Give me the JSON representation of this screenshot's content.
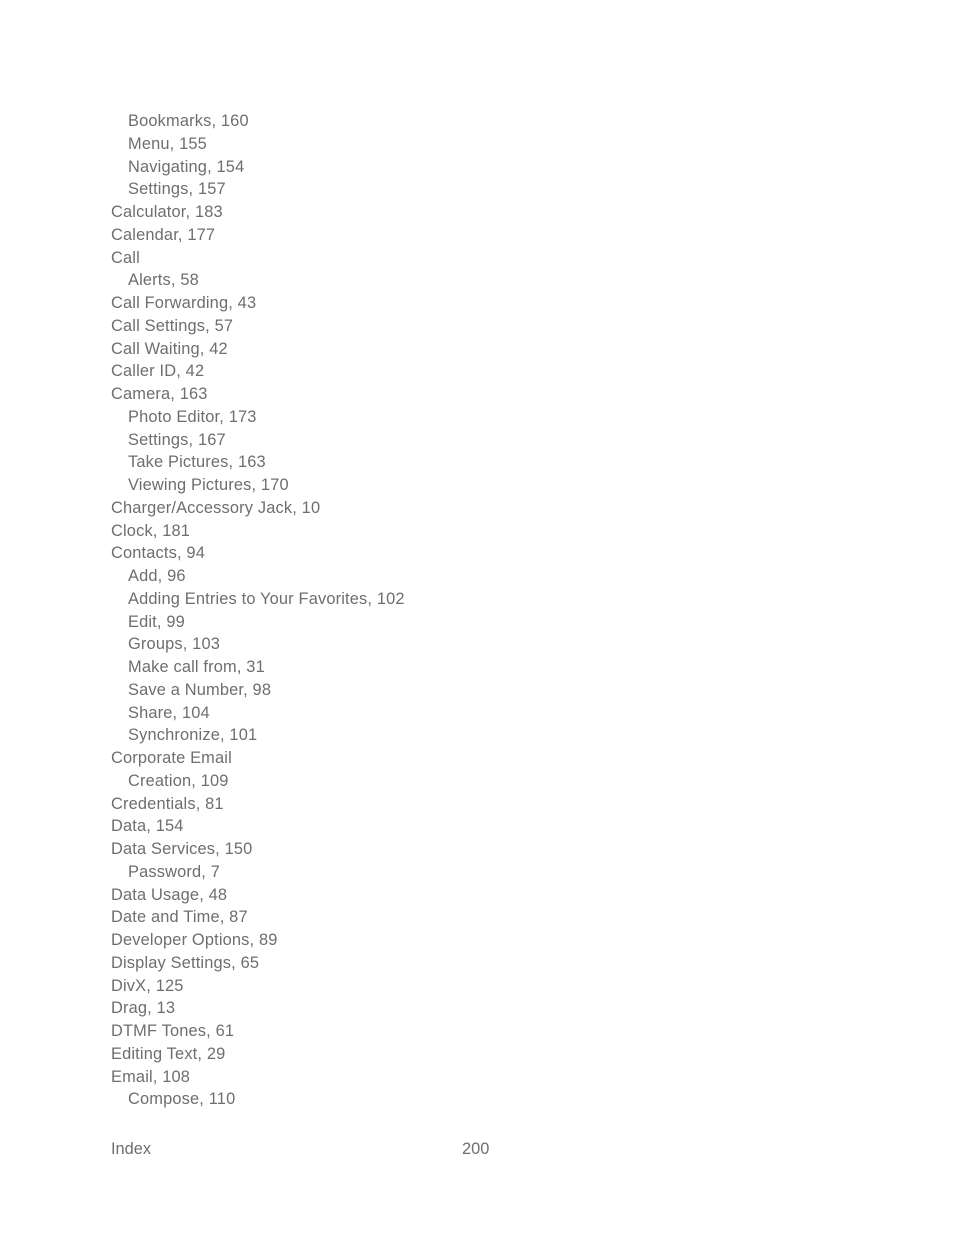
{
  "page": {
    "background_color": "#ffffff",
    "text_color": "#6e6e6e"
  },
  "index": {
    "entries": [
      {
        "text": "Bookmarks, 160",
        "level": 1
      },
      {
        "text": "Menu, 155",
        "level": 1
      },
      {
        "text": "Navigating, 154",
        "level": 1
      },
      {
        "text": "Settings, 157",
        "level": 1
      },
      {
        "text": "Calculator, 183",
        "level": 0
      },
      {
        "text": "Calendar, 177",
        "level": 0
      },
      {
        "text": "Call",
        "level": 0
      },
      {
        "text": "Alerts, 58",
        "level": 1
      },
      {
        "text": "Call Forwarding, 43",
        "level": 0
      },
      {
        "text": "Call Settings, 57",
        "level": 0
      },
      {
        "text": "Call Waiting, 42",
        "level": 0
      },
      {
        "text": "Caller ID, 42",
        "level": 0
      },
      {
        "text": "Camera, 163",
        "level": 0
      },
      {
        "text": "Photo Editor, 173",
        "level": 1
      },
      {
        "text": "Settings, 167",
        "level": 1
      },
      {
        "text": "Take Pictures, 163",
        "level": 1
      },
      {
        "text": "Viewing Pictures, 170",
        "level": 1
      },
      {
        "text": "Charger/Accessory Jack, 10",
        "level": 0
      },
      {
        "text": "Clock, 181",
        "level": 0
      },
      {
        "text": "Contacts, 94",
        "level": 0
      },
      {
        "text": "Add, 96",
        "level": 1
      },
      {
        "text": "Adding Entries to Your Favorites, 102",
        "level": 1
      },
      {
        "text": "Edit, 99",
        "level": 1
      },
      {
        "text": "Groups, 103",
        "level": 1
      },
      {
        "text": "Make call from, 31",
        "level": 1
      },
      {
        "text": "Save a Number, 98",
        "level": 1
      },
      {
        "text": "Share, 104",
        "level": 1
      },
      {
        "text": "Synchronize, 101",
        "level": 1
      },
      {
        "text": "Corporate Email",
        "level": 0
      },
      {
        "text": "Creation, 109",
        "level": 1
      },
      {
        "text": "Credentials, 81",
        "level": 0
      },
      {
        "text": "Data, 154",
        "level": 0
      },
      {
        "text": "Data Services, 150",
        "level": 0
      },
      {
        "text": "Password, 7",
        "level": 1
      },
      {
        "text": "Data Usage, 48",
        "level": 0
      },
      {
        "text": "Date and Time, 87",
        "level": 0
      },
      {
        "text": "Developer Options, 89",
        "level": 0
      },
      {
        "text": "Display Settings, 65",
        "level": 0
      },
      {
        "text": "DivX, 125",
        "level": 0
      },
      {
        "text": "Drag, 13",
        "level": 0
      },
      {
        "text": "DTMF Tones, 61",
        "level": 0
      },
      {
        "text": "Editing Text, 29",
        "level": 0
      },
      {
        "text": "Email, 108",
        "level": 0
      },
      {
        "text": "Compose, 110",
        "level": 1
      }
    ]
  },
  "footer": {
    "label": "Index",
    "page_number": "200"
  }
}
